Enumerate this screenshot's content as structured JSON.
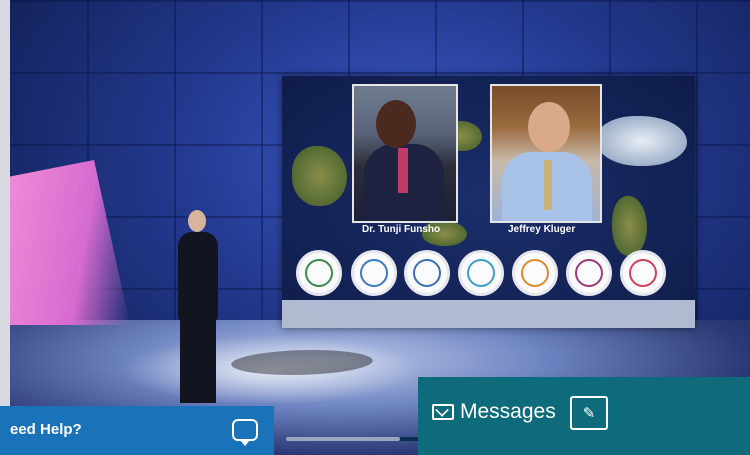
{
  "stage": {
    "speakers": [
      {
        "name": "Dr. Tunji Funsho"
      },
      {
        "name": "Jeffrey Kluger"
      }
    ],
    "topic_icons": [
      {
        "icon": "plant-icon",
        "color": "#3a8a4a"
      },
      {
        "icon": "water-drop-icon",
        "color": "#3a7bbf"
      },
      {
        "icon": "dove-icon",
        "color": "#3a6fb0"
      },
      {
        "icon": "bar-chart-icon",
        "color": "#3aa0c8"
      },
      {
        "icon": "pencil-icon",
        "color": "#e08a2a"
      },
      {
        "icon": "mother-child-icon",
        "color": "#9a3a7a"
      },
      {
        "icon": "baby-icon",
        "color": "#d0405a"
      }
    ]
  },
  "help_bar": {
    "label": "eed Help?",
    "icon": "chat-bubble-icon"
  },
  "messages_bar": {
    "label": "Messages",
    "mail_icon": "envelope-icon",
    "compose_icon": "compose-icon"
  },
  "scrollbar": {
    "thumb_fraction": 0.48
  }
}
